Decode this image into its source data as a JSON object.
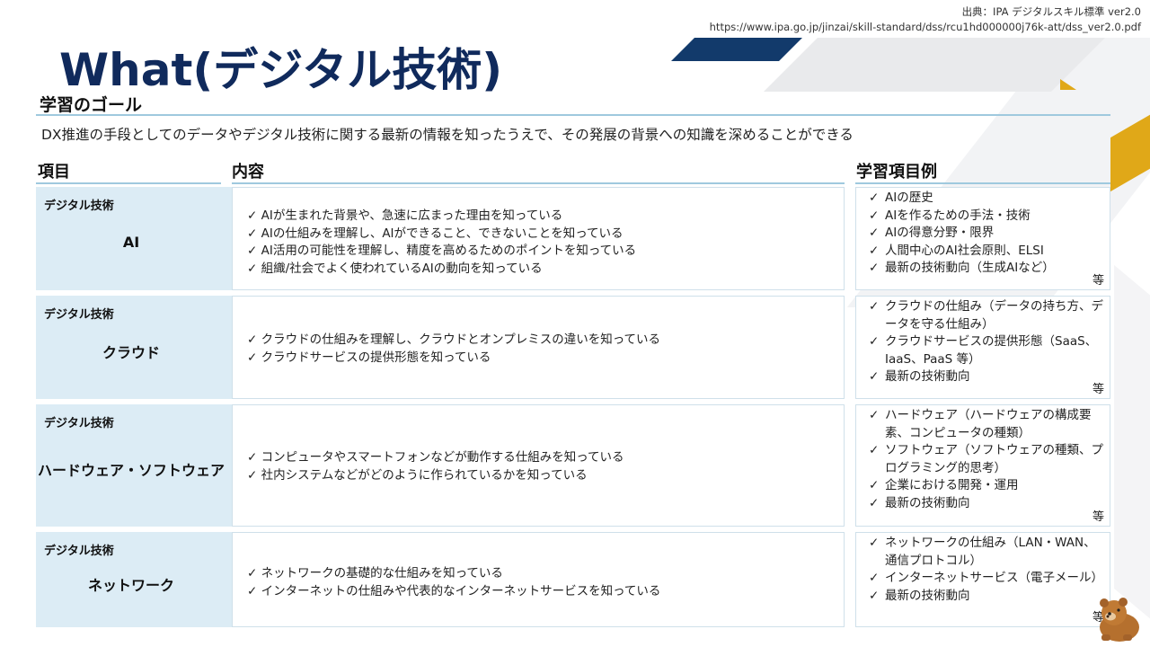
{
  "source": {
    "line1": "出典：IPA デジタルスキル標準 ver2.0",
    "line2": "https://www.ipa.go.jp/jinzai/skill-standard/dss/rcu1hd000000j76k-att/dss_ver2.0.pdf"
  },
  "title": "What(デジタル技術)",
  "goal": {
    "heading": "学習のゴール",
    "text": "DX推進の手段としてのデータやデジタル技術に関する最新の情報を知ったうえで、その発展の背景への知識を深めることができる"
  },
  "columns": {
    "item": "項目",
    "content": "内容",
    "examples": "学習項目例"
  },
  "check": "✓",
  "etc": "等",
  "rows": [
    {
      "category": "デジタル技術",
      "name": "AI",
      "content": [
        "AIが生まれた背景や、急速に広まった理由を知っている",
        "AIの仕組みを理解し、AIができること、できないことを知っている",
        "AI活用の可能性を理解し、精度を高めるためのポイントを知っている",
        "組織/社会でよく使われているAIの動向を知っている"
      ],
      "examples": [
        "AIの歴史",
        "AIを作るための手法・技術",
        "AIの得意分野・限界",
        "人間中心のAI社会原則、ELSI",
        "最新の技術動向（生成AIなど）"
      ]
    },
    {
      "category": "デジタル技術",
      "name": "クラウド",
      "content": [
        "クラウドの仕組みを理解し、クラウドとオンプレミスの違いを知っている",
        "クラウドサービスの提供形態を知っている"
      ],
      "examples": [
        "クラウドの仕組み（データの持ち方、データを守る仕組み）",
        "クラウドサービスの提供形態（SaaS、IaaS、PaaS 等）",
        "最新の技術動向"
      ]
    },
    {
      "category": "デジタル技術",
      "name": "ハードウェア・ソフトウェア",
      "content": [
        "コンピュータやスマートフォンなどが動作する仕組みを知っている",
        "社内システムなどがどのように作られているかを知っている"
      ],
      "examples": [
        "ハードウェア（ハードウェアの構成要素、コンピュータの種類）",
        "ソフトウェア（ソフトウェアの種類、プログラミング的思考）",
        "企業における開発・運用",
        "最新の技術動向"
      ]
    },
    {
      "category": "デジタル技術",
      "name": "ネットワーク",
      "content": [
        "ネットワークの基礎的な仕組みを知っている",
        "インターネットの仕組みや代表的なインターネットサービスを知っている"
      ],
      "examples": [
        "ネットワークの仕組み（LAN・WAN、通信プロトコル）",
        "インターネットサービス（電子メール）",
        "最新の技術動向"
      ]
    }
  ],
  "mascot": "bear-mascot"
}
